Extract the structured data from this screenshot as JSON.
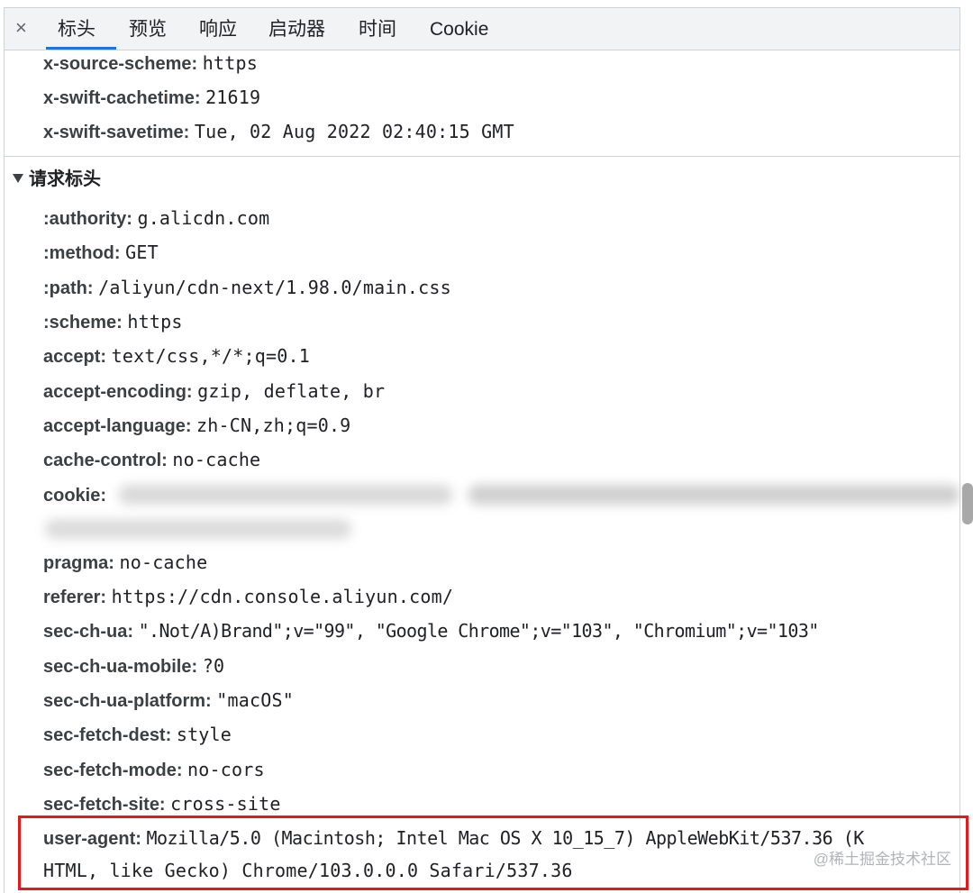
{
  "tabs": {
    "close_glyph": "×",
    "items": [
      "标头",
      "预览",
      "响应",
      "启动器",
      "时间",
      "Cookie"
    ],
    "active": "标头"
  },
  "response_tail": [
    {
      "key": "x-source-scheme:",
      "value": "https"
    },
    {
      "key": "x-swift-cachetime:",
      "value": "21619"
    },
    {
      "key": "x-swift-savetime:",
      "value": "Tue, 02 Aug 2022 02:40:15 GMT"
    }
  ],
  "request_section": {
    "title": "请求标头",
    "headers": [
      {
        "key": ":authority:",
        "value": "g.alicdn.com"
      },
      {
        "key": ":method:",
        "value": "GET"
      },
      {
        "key": ":path:",
        "value": "/aliyun/cdn-next/1.98.0/main.css"
      },
      {
        "key": ":scheme:",
        "value": "https"
      },
      {
        "key": "accept:",
        "value": "text/css,*/*;q=0.1"
      },
      {
        "key": "accept-encoding:",
        "value": "gzip, deflate, br"
      },
      {
        "key": "accept-language:",
        "value": "zh-CN,zh;q=0.9"
      },
      {
        "key": "cache-control:",
        "value": "no-cache"
      },
      {
        "key": "cookie:",
        "value": ""
      },
      {
        "key": "pragma:",
        "value": "no-cache"
      },
      {
        "key": "referer:",
        "value": "https://cdn.console.aliyun.com/"
      },
      {
        "key": "sec-ch-ua:",
        "value": "\".Not/A)Brand\";v=\"99\", \"Google Chrome\";v=\"103\", \"Chromium\";v=\"103\""
      },
      {
        "key": "sec-ch-ua-mobile:",
        "value": "?0"
      },
      {
        "key": "sec-ch-ua-platform:",
        "value": "\"macOS\""
      },
      {
        "key": "sec-fetch-dest:",
        "value": "style"
      },
      {
        "key": "sec-fetch-mode:",
        "value": "no-cors"
      },
      {
        "key": "sec-fetch-site:",
        "value": "cross-site"
      },
      {
        "key": "user-agent:",
        "value": "Mozilla/5.0 (Macintosh; Intel Mac OS X 10_15_7) AppleWebKit/537.36 (K",
        "value_line2": "HTML, like Gecko) Chrome/103.0.0.0 Safari/537.36"
      }
    ]
  },
  "watermark": "@稀土掘金技术社区",
  "colors": {
    "highlight": "#e3191e",
    "active_tab": "#1a73e8"
  }
}
